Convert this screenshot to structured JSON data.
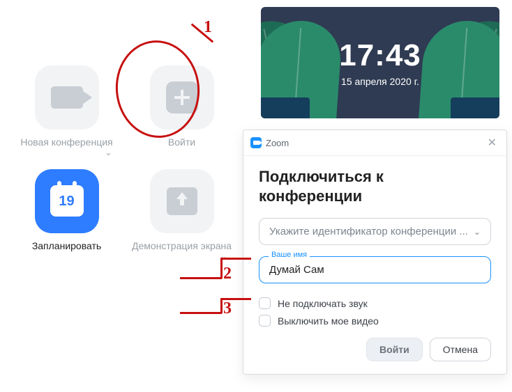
{
  "clock": {
    "time": "17:43",
    "date": "15 апреля 2020 г."
  },
  "tiles": {
    "newconf": {
      "label": "Новая конференция"
    },
    "join": {
      "label": "Войти"
    },
    "schedule": {
      "label": "Запланировать",
      "day": "19"
    },
    "share": {
      "label": "Демонстрация экрана"
    }
  },
  "dialog": {
    "app": "Zoom",
    "heading": "Подключиться к конференции",
    "id_placeholder": "Укажите идентификатор конференции ...",
    "name_label": "Ваше имя",
    "name_value": "Думай Сам",
    "opt_noaudio": "Не подключать звук",
    "opt_novideo": "Выключить мое видео",
    "join_btn": "Войти",
    "cancel_btn": "Отмена"
  },
  "annotations": {
    "n1": "1",
    "n2": "2",
    "n3": "3"
  }
}
